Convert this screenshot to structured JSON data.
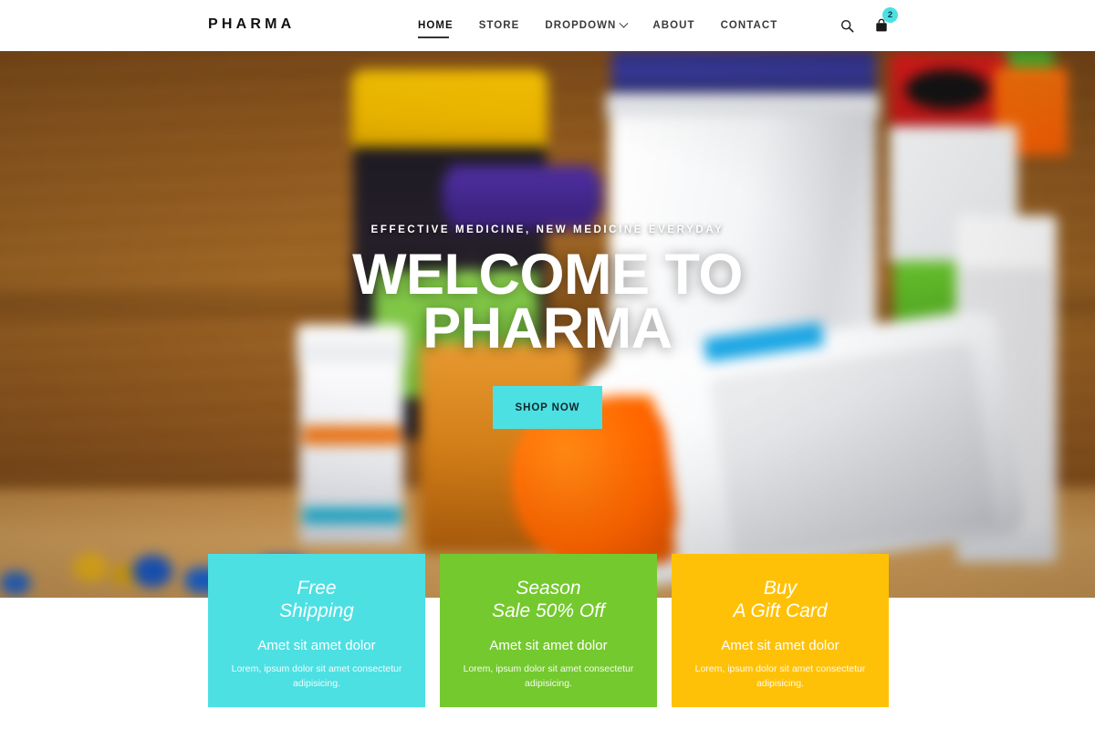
{
  "header": {
    "logo": "PHARMA",
    "nav": [
      {
        "label": "HOME",
        "active": true,
        "has_dropdown": false
      },
      {
        "label": "STORE",
        "active": false,
        "has_dropdown": false
      },
      {
        "label": "DROPDOWN",
        "active": false,
        "has_dropdown": true
      },
      {
        "label": "ABOUT",
        "active": false,
        "has_dropdown": false
      },
      {
        "label": "CONTACT",
        "active": false,
        "has_dropdown": false
      }
    ],
    "icons": {
      "search": "search-icon",
      "cart": "shopping-bag-icon",
      "cart_count": "2"
    }
  },
  "hero": {
    "kicker": "EFFECTIVE MEDICINE, NEW MEDICINE EVERYDAY",
    "headline_line1": "WELCOME TO",
    "headline_line2": "PHARMA",
    "cta_label": "SHOP NOW"
  },
  "cards": [
    {
      "title_line1": "Free",
      "title_line2": "Shipping",
      "subtitle": "Amet sit amet dolor",
      "body": "Lorem, ipsum dolor sit amet consectetur adipisicing.",
      "color": "#4ce0e3"
    },
    {
      "title_line1": "Season",
      "title_line2": "Sale 50% Off",
      "subtitle": "Amet sit amet dolor",
      "body": "Lorem, ipsum dolor sit amet consectetur adipisicing.",
      "color": "#74c92e"
    },
    {
      "title_line1": "Buy",
      "title_line2": "A Gift Card",
      "subtitle": "Amet sit amet dolor",
      "body": "Lorem, ipsum dolor sit amet consectetur adipisicing.",
      "color": "#ffc107"
    }
  ],
  "colors": {
    "accent_cyan": "#4ce0e3",
    "accent_green": "#74c92e",
    "accent_yellow": "#ffc107",
    "text_dark": "#111111"
  }
}
